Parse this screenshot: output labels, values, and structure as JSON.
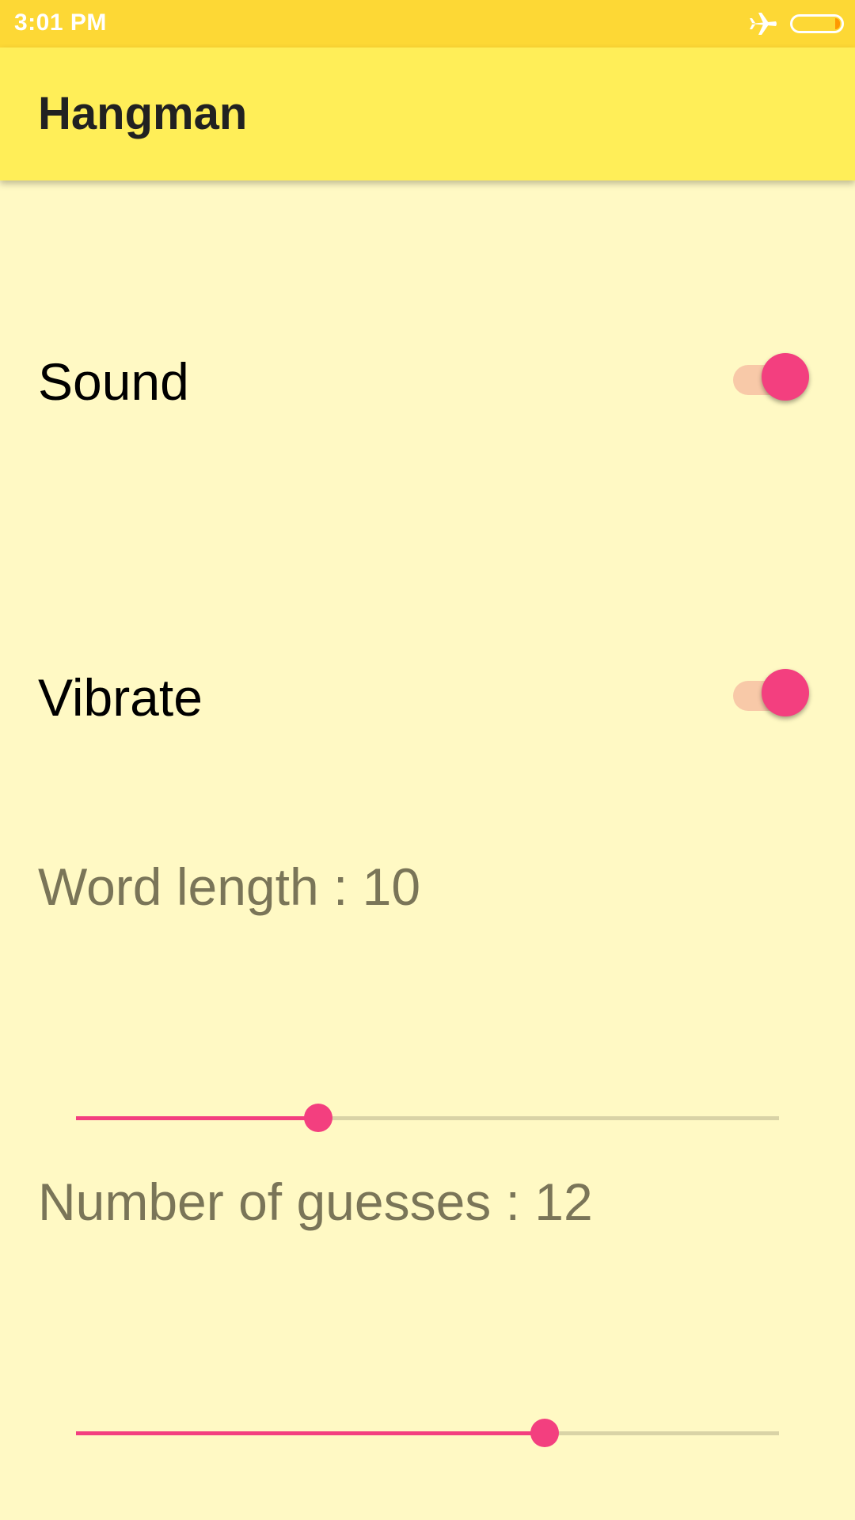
{
  "status_bar": {
    "time": "3:01 PM",
    "icons": [
      "airplane-mode-icon",
      "battery-icon"
    ]
  },
  "app_bar": {
    "title": "Hangman"
  },
  "settings": {
    "sound": {
      "label": "Sound",
      "enabled": true
    },
    "vibrate": {
      "label": "Vibrate",
      "enabled": true
    },
    "word_length": {
      "label": "Word length : 10",
      "fraction": 0.345
    },
    "guesses": {
      "label": "Number of guesses : 12",
      "fraction": 0.667
    }
  },
  "colors": {
    "status_bar": "#fdd835",
    "app_bar": "#ffee58",
    "background": "#fff9c4",
    "accent": "#f33f7f",
    "switch_track": "#f8c9a8",
    "slider_track": "#d9d3a6"
  }
}
